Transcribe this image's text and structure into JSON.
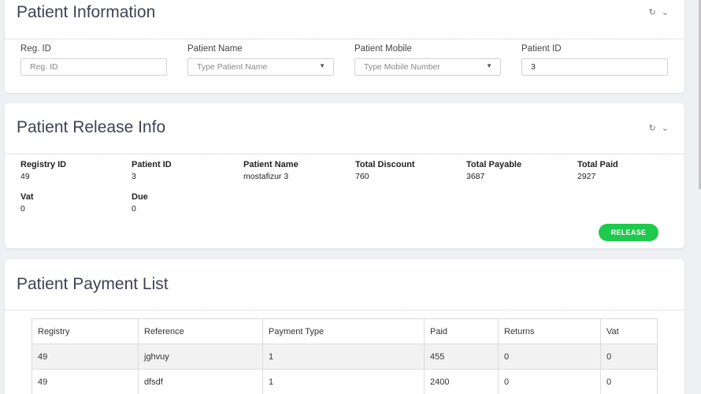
{
  "patient_info": {
    "title": "Patient Information",
    "tools": "↻ ⌄",
    "fields": [
      {
        "label": "Reg. ID",
        "placeholder": "Reg. ID"
      },
      {
        "label": "Patient Name",
        "placeholder": "Type Patient Name"
      },
      {
        "label": "Patient Mobile",
        "placeholder": "Type Mobile Number"
      },
      {
        "label": "Patient ID",
        "value": "3"
      }
    ]
  },
  "release_info": {
    "title": "Patient Release Info",
    "tools": "↻ ⌄",
    "items": [
      {
        "label": "Registry ID",
        "value": "49"
      },
      {
        "label": "Patient ID",
        "value": "3"
      },
      {
        "label": "Patient Name",
        "value": "mostafizur 3"
      },
      {
        "label": "Total Discount",
        "value": "760"
      },
      {
        "label": "Total Payable",
        "value": "3687"
      },
      {
        "label": "Total Paid",
        "value": "2927"
      },
      {
        "label": "Vat",
        "value": "0"
      },
      {
        "label": "Due",
        "value": "0"
      }
    ],
    "release_label": "RELEASE",
    "release_color": "#1ec94c"
  },
  "payment_list": {
    "title": "Patient Payment List",
    "columns": [
      "Registry",
      "Reference",
      "Payment Type",
      "Paid",
      "Returns",
      "Vat"
    ],
    "rows": [
      [
        "49",
        "jghvuy",
        "1",
        "455",
        "0",
        "0"
      ],
      [
        "49",
        "dfsdf",
        "1",
        "2400",
        "0",
        "0"
      ]
    ]
  }
}
